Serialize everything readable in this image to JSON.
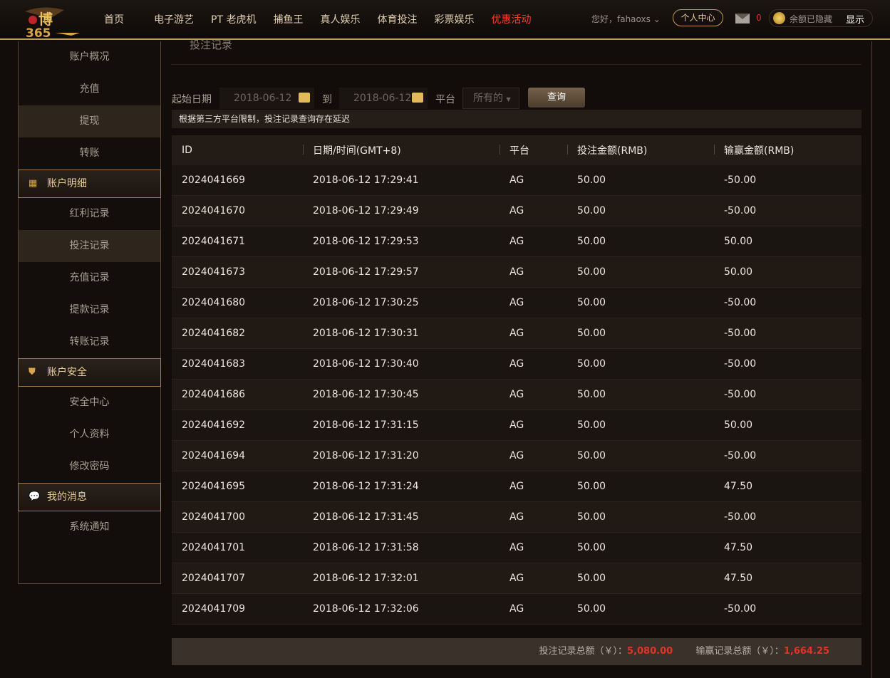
{
  "header": {
    "logo": "博365",
    "nav": [
      "首页",
      "电子游艺",
      "PT 老虎机",
      "捕鱼王",
      "真人娱乐",
      "体育投注",
      "彩票娱乐",
      "优惠活动"
    ],
    "greeting": "您好，fahaoxs",
    "personal_center": "个人中心",
    "mail_count": "0",
    "balance_hidden": "余额已隐藏",
    "show": "显示"
  },
  "sidebar": {
    "top_items": [
      "账户概况",
      "充值",
      "提现",
      "转账"
    ],
    "sections": [
      {
        "title": "账户明细",
        "items": [
          "红利记录",
          "投注记录",
          "充值记录",
          "提款记录",
          "转账记录"
        ]
      },
      {
        "title": "账户安全",
        "items": [
          "安全中心",
          "个人资料",
          "修改密码"
        ]
      },
      {
        "title": "我的消息",
        "items": [
          "系统通知"
        ]
      }
    ]
  },
  "main": {
    "title": "投注记录",
    "start_label": "起始日期",
    "start_date": "2018-06-12",
    "to_label": "到",
    "end_date": "2018-06-12",
    "platform_label": "平台",
    "platform_value": "所有的",
    "query": "查询",
    "note": "根据第三方平台限制，投注记录查询存在延迟"
  },
  "table": {
    "headers": [
      "ID",
      "日期/时间(GMT+8)",
      "平台",
      "投注金额(RMB)",
      "输赢金额(RMB)"
    ],
    "rows": [
      [
        "2024041669",
        "2018-06-12 17:29:41",
        "AG",
        "50.00",
        "-50.00"
      ],
      [
        "2024041670",
        "2018-06-12 17:29:49",
        "AG",
        "50.00",
        "-50.00"
      ],
      [
        "2024041671",
        "2018-06-12 17:29:53",
        "AG",
        "50.00",
        "50.00"
      ],
      [
        "2024041673",
        "2018-06-12 17:29:57",
        "AG",
        "50.00",
        "50.00"
      ],
      [
        "2024041680",
        "2018-06-12 17:30:25",
        "AG",
        "50.00",
        "-50.00"
      ],
      [
        "2024041682",
        "2018-06-12 17:30:31",
        "AG",
        "50.00",
        "-50.00"
      ],
      [
        "2024041683",
        "2018-06-12 17:30:40",
        "AG",
        "50.00",
        "-50.00"
      ],
      [
        "2024041686",
        "2018-06-12 17:30:45",
        "AG",
        "50.00",
        "-50.00"
      ],
      [
        "2024041692",
        "2018-06-12 17:31:15",
        "AG",
        "50.00",
        "50.00"
      ],
      [
        "2024041694",
        "2018-06-12 17:31:20",
        "AG",
        "50.00",
        "-50.00"
      ],
      [
        "2024041695",
        "2018-06-12 17:31:24",
        "AG",
        "50.00",
        "47.50"
      ],
      [
        "2024041700",
        "2018-06-12 17:31:45",
        "AG",
        "50.00",
        "-50.00"
      ],
      [
        "2024041701",
        "2018-06-12 17:31:58",
        "AG",
        "50.00",
        "47.50"
      ],
      [
        "2024041707",
        "2018-06-12 17:32:01",
        "AG",
        "50.00",
        "47.50"
      ],
      [
        "2024041709",
        "2018-06-12 17:32:06",
        "AG",
        "50.00",
        "-50.00"
      ]
    ]
  },
  "totals": {
    "bet_label": "投注记录总额（￥）：",
    "bet_value": "5,080.00",
    "win_label": "输赢记录总额（￥）：",
    "win_value": "1,664.25"
  }
}
